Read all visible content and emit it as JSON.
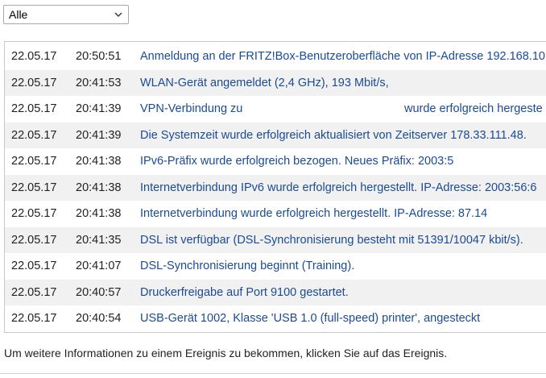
{
  "filter": {
    "selected": "Alle"
  },
  "events": [
    {
      "date": "22.05.17",
      "time": "20:50:51",
      "message": "Anmeldung an der FRITZ!Box-Benutzeroberfläche von IP-Adresse 192.168.10"
    },
    {
      "date": "22.05.17",
      "time": "20:41:53",
      "message": "WLAN-Gerät angemeldet (2,4 GHz), 193 Mbit/s,"
    },
    {
      "date": "22.05.17",
      "time": "20:41:39",
      "message": "VPN-Verbindung zu",
      "message_tail": "wurde erfolgreich hergeste"
    },
    {
      "date": "22.05.17",
      "time": "20:41:39",
      "message": "Die Systemzeit wurde erfolgreich aktualisiert von Zeitserver 178.33.111.48."
    },
    {
      "date": "22.05.17",
      "time": "20:41:38",
      "message": "IPv6-Präfix wurde erfolgreich bezogen. Neues Präfix: 2003:5"
    },
    {
      "date": "22.05.17",
      "time": "20:41:38",
      "message": "Internetverbindung IPv6 wurde erfolgreich hergestellt. IP-Adresse: 2003:56:6"
    },
    {
      "date": "22.05.17",
      "time": "20:41:38",
      "message": "Internetverbindung wurde erfolgreich hergestellt. IP-Adresse: 87.14"
    },
    {
      "date": "22.05.17",
      "time": "20:41:35",
      "message": "DSL ist verfügbar (DSL-Synchronisierung besteht mit 51391/10047 kbit/s)."
    },
    {
      "date": "22.05.17",
      "time": "20:41:07",
      "message": "DSL-Synchronisierung beginnt (Training)."
    },
    {
      "date": "22.05.17",
      "time": "20:40:57",
      "message": "Druckerfreigabe auf Port 9100 gestartet."
    },
    {
      "date": "22.05.17",
      "time": "20:40:54",
      "message": "USB-Gerät 1002, Klasse 'USB 1.0 (full-speed) printer', angesteckt"
    }
  ],
  "hint": "Um weitere Informationen zu einem Ereignis zu bekommen, klicken Sie auf das Ereignis.",
  "colors": {
    "link": "#1a4b95",
    "row_alt": "#f1f1f1",
    "border": "#c8c8c8"
  }
}
